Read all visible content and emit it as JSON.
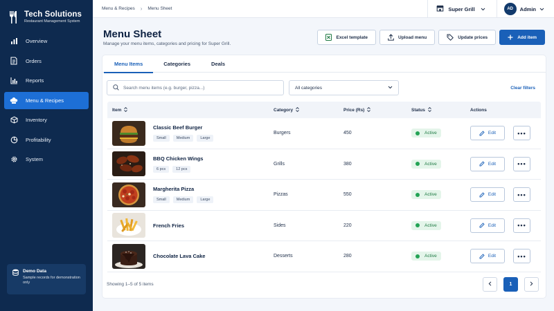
{
  "brand": {
    "name": "Tech Solutions",
    "tagline": "Restaurant Management System",
    "icon": "fork-knife-icon"
  },
  "sidebar": {
    "items": [
      {
        "label": "Overview",
        "icon": "bar-chart-icon",
        "active": false
      },
      {
        "label": "Orders",
        "icon": "document-icon",
        "active": false
      },
      {
        "label": "Reports",
        "icon": "report-chart-icon",
        "active": false
      },
      {
        "label": "Menu & Recipes",
        "icon": "chef-hat-icon",
        "active": true
      },
      {
        "label": "Inventory",
        "icon": "box-icon",
        "active": false
      },
      {
        "label": "Profitability",
        "icon": "pie-chart-icon",
        "active": false
      },
      {
        "label": "System",
        "icon": "gear-icon",
        "active": false
      }
    ],
    "demo": {
      "title": "Demo Data",
      "text": "Sample records for demonstration only",
      "icon": "database-icon"
    }
  },
  "topbar": {
    "breadcrumb": [
      "Menu & Recipes",
      "Menu Sheet"
    ],
    "store": "Super Grill",
    "user": {
      "initials": "AD",
      "name": "Admin"
    }
  },
  "header": {
    "title": "Menu Sheet",
    "subtitle": "Manage your menu items, categories and pricing for Super Grill."
  },
  "actions": {
    "excel": "Excel template",
    "upload": "Upload menu",
    "update": "Update prices",
    "add": "Add item"
  },
  "tabs": [
    "Menu Items",
    "Categories",
    "Deals"
  ],
  "filters": {
    "search_placeholder": "Search menu items (e.g. burger, pizza...)",
    "category": "All categories",
    "clear": "Clear filters"
  },
  "table": {
    "columns": [
      "Item",
      "Category",
      "Price (Rs)",
      "Status",
      "Actions"
    ],
    "edit_label": "Edit",
    "more_label": "•••",
    "rows": [
      {
        "name": "Classic Beef Burger",
        "variants": [
          "Small",
          "Medium",
          "Large"
        ],
        "category": "Burgers",
        "price": "450",
        "status": "Active"
      },
      {
        "name": "BBQ Chicken Wings",
        "variants": [
          "6 pcs",
          "12 pcs"
        ],
        "category": "Grills",
        "price": "380",
        "status": "Active"
      },
      {
        "name": "Margherita Pizza",
        "variants": [
          "Small",
          "Medium",
          "Large"
        ],
        "category": "Pizzas",
        "price": "550",
        "status": "Active"
      },
      {
        "name": "French Fries",
        "variants": [],
        "category": "Sides",
        "price": "220",
        "status": "Active"
      },
      {
        "name": "Chocolate Lava Cake",
        "variants": [],
        "category": "Desserts",
        "price": "280",
        "status": "Active"
      }
    ]
  },
  "pagination": {
    "summary": "Showing 1–5 of 5 items",
    "current": "1"
  },
  "colors": {
    "sidebar": "#0e2a4f",
    "accent": "#1a60b8",
    "active_nav": "#1d6fd6",
    "success": "#23a355"
  }
}
